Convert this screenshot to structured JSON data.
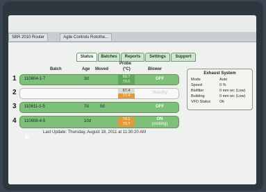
{
  "browser": {
    "tabs": [
      "SBR 2010 Router",
      "Agile Controls Rotothe..."
    ]
  },
  "app_tabs": [
    "Status",
    "Batches",
    "Reports",
    "Settings",
    "Support"
  ],
  "active_tab": "Status",
  "table": {
    "headers": {
      "batch": "Batch",
      "age": "Age",
      "moved": "Moved",
      "probe": "Probe",
      "probe_unit": "(°C)",
      "blower": "Blower"
    },
    "rows": [
      {
        "num": "1",
        "batch": "110604-1-7",
        "age": "3d",
        "moved": "",
        "probe_top": "69.7",
        "probe_bottom": "70.0",
        "blower": "OFF",
        "blower_sub": ""
      },
      {
        "num": "2",
        "batch": "",
        "age": "",
        "moved": "",
        "probe_top": "67.4",
        "probe_bottom": "77.4",
        "blower": "Standby",
        "blower_sub": ""
      },
      {
        "num": "3",
        "batch": "110611-1-5",
        "age": "7d",
        "moved": "0d",
        "probe_top": "",
        "probe_bottom": "",
        "blower": "OFF",
        "blower_sub": ""
      },
      {
        "num": "4",
        "batch": "110608-4-5",
        "age": "10d",
        "moved": "",
        "probe_top": "74.1",
        "probe_bottom": "73.7",
        "blower": "ON",
        "blower_sub": "(cooling)"
      }
    ]
  },
  "exhaust": {
    "title": "Exhaust System",
    "mode_label": "Mode",
    "mode_value": "Auto",
    "speed_label": "Speed",
    "speed_value": "0 %",
    "biofilter_label": "Biofilter",
    "biofilter_value": "0 mm wc (Low)",
    "building_label": "Building",
    "building_value": "0 mm wc (Low)",
    "vfd_label": "VFD Status",
    "vfd_value": "Ok"
  },
  "last_update": "Last Update: Thursday, August 18, 2011 at 11:30:20 AM",
  "colors": {
    "row_green": "#7ec07a",
    "probe_green": "#5fa85b",
    "probe_orange": "#e39a3c",
    "probe_gray": "#b9bcb6"
  }
}
